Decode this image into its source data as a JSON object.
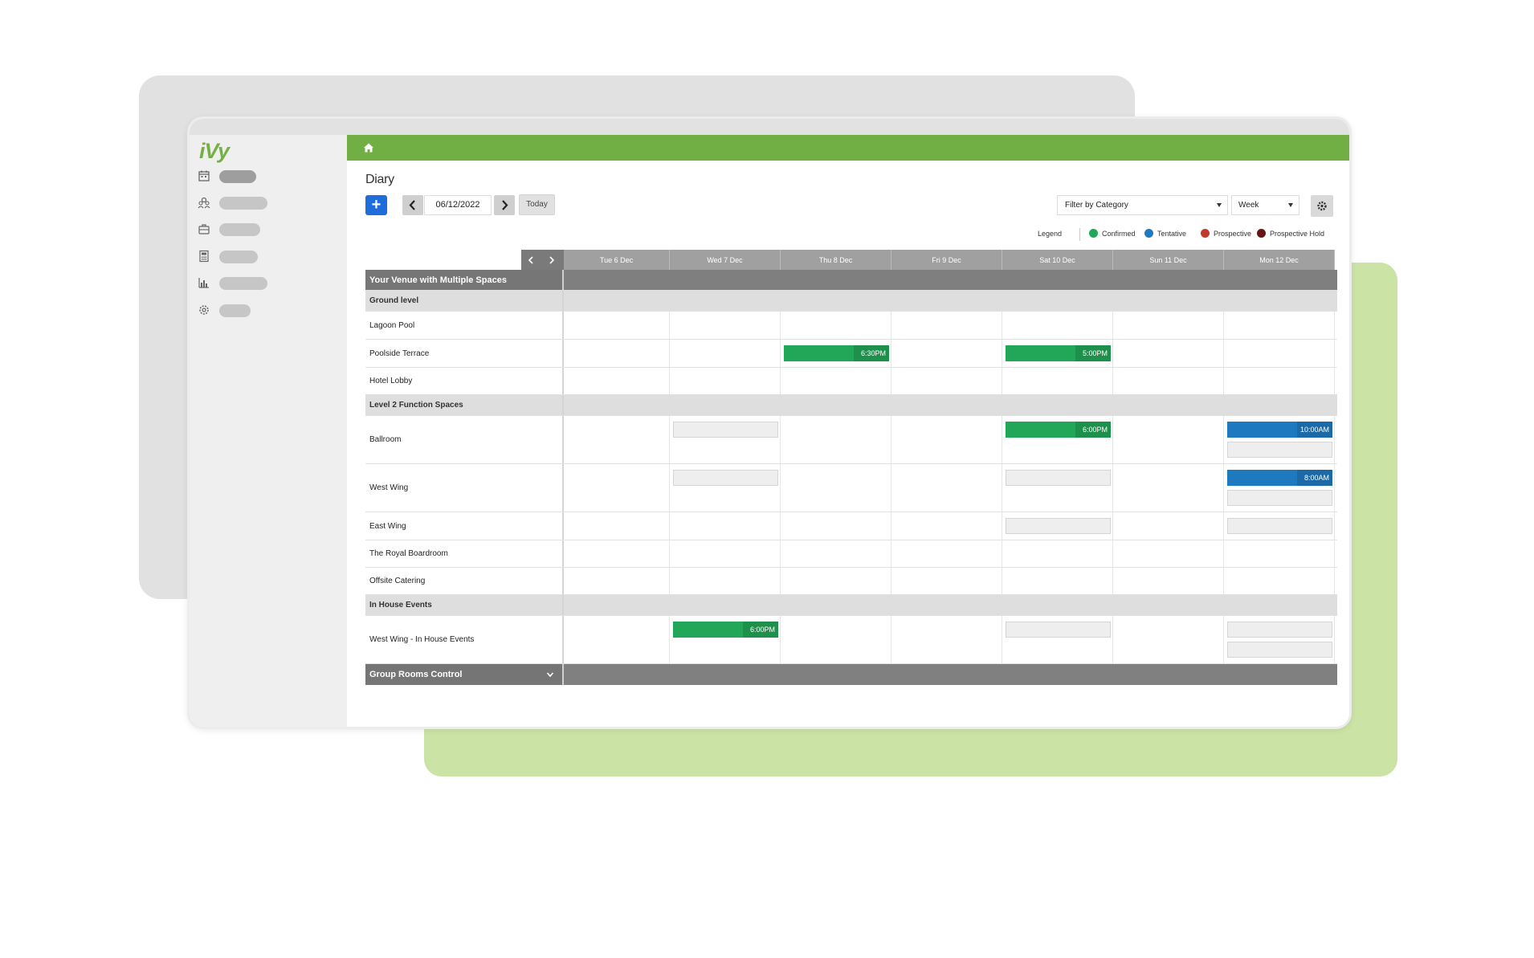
{
  "app": {
    "logo": "iVy"
  },
  "diary": {
    "title": "Diary",
    "add_label": "+",
    "date_value": "06/12/2022",
    "today_label": "Today",
    "filter_label": "Filter by Category",
    "view_label": "Week"
  },
  "legend": {
    "title": "Legend",
    "items": [
      {
        "label": "Confirmed",
        "color": "#22a657"
      },
      {
        "label": "Tentative",
        "color": "#1f79bf"
      },
      {
        "label": "Prospective",
        "color": "#c23a2c"
      },
      {
        "label": "Prospective Hold",
        "color": "#6b1212"
      }
    ]
  },
  "days": [
    "Tue 6 Dec",
    "Wed 7 Dec",
    "Thu 8 Dec",
    "Fri 9 Dec",
    "Sat 10 Dec",
    "Sun 11 Dec",
    "Mon 12 Dec"
  ],
  "venue": "Your Venue with Multiple Spaces",
  "groups": {
    "ground": "Ground level",
    "level2": "Level 2 Function Spaces",
    "inhouse": "In House Events"
  },
  "spaces": {
    "lagoon": "Lagoon Pool",
    "poolside": "Poolside Terrace",
    "lobby": "Hotel Lobby",
    "ballroom": "Ballroom",
    "westwing": "West Wing",
    "eastwing": "East Wing",
    "boardroom": "The Royal Boardroom",
    "catering": "Offsite Catering",
    "westwing_inhouse": "West Wing - In House Events"
  },
  "events": {
    "poolside_thu": "6:30PM",
    "poolside_sat": "5:00PM",
    "ballroom_sat": "6:00PM",
    "ballroom_mon": "10:00AM",
    "westwing_mon": "8:00AM",
    "inhouse_wed": "6:00PM"
  },
  "footer": {
    "label": "Group Rooms Control"
  },
  "colors": {
    "brand_green": "#71ae44",
    "confirmed": "#22a657",
    "tentative": "#1f79bf",
    "primary_button": "#1f6ddb"
  }
}
